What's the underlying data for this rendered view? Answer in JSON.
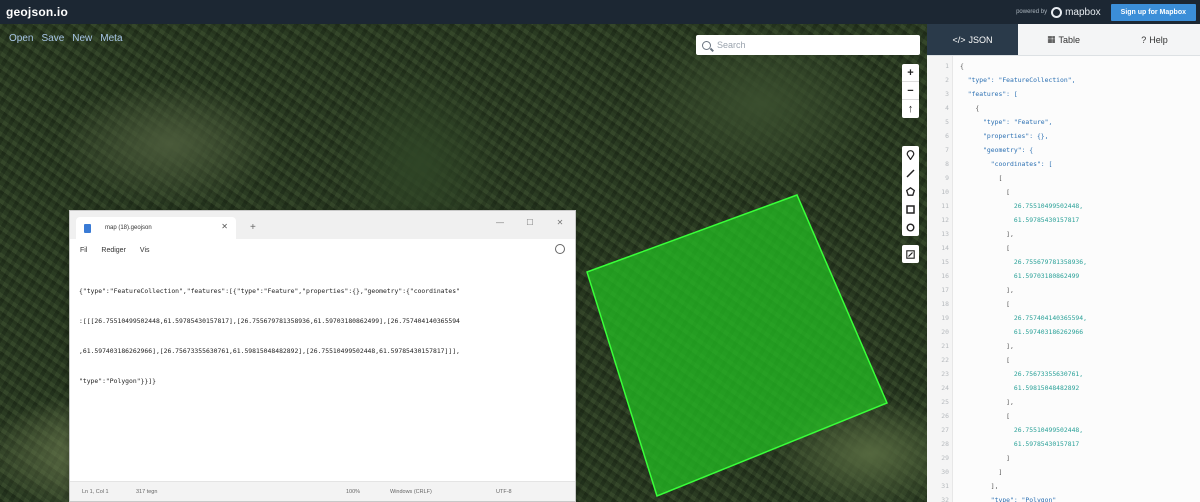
{
  "topbar": {
    "brand": "geojson.io",
    "powered_by": "powered by",
    "mapbox_label": "mapbox",
    "signup_label": "Sign up for Mapbox"
  },
  "map": {
    "menu": [
      "Open",
      "Save",
      "New",
      "Meta"
    ],
    "search_placeholder": "Search",
    "zoom_controls": [
      "+",
      "−",
      "↑"
    ],
    "draw_tools": [
      "marker-icon",
      "line-icon",
      "polygon-icon",
      "rectangle-icon",
      "circle-icon"
    ],
    "edit_tool": "edit-icon",
    "polygon_color": "#22c322"
  },
  "notepad": {
    "tab_title": "map (18).geojson",
    "menu": [
      "Fil",
      "Rediger",
      "Vis"
    ],
    "content_lines": [
      "{\"type\":\"FeatureCollection\",\"features\":[{\"type\":\"Feature\",\"properties\":{},\"geometry\":{\"coordinates\"",
      ":[[[26.75510499502448,61.59785430157817],[26.755679781358936,61.59703180862499],[26.757404140365594",
      ",61.597403186262966],[26.75673355630761,61.59815048482892],[26.75510499502448,61.59785430157817]]],",
      "\"type\":\"Polygon\"}}]}"
    ],
    "status": {
      "position": "Ln 1, Col 1",
      "chars": "317 tegn",
      "zoom": "100%",
      "line_ending": "Windows (CRLF)",
      "encoding": "UTF-8"
    }
  },
  "panel": {
    "tabs": [
      {
        "icon": "</>",
        "label": "JSON"
      },
      {
        "icon": "▦",
        "label": "Table"
      },
      {
        "icon": "?",
        "label": "Help"
      }
    ],
    "line_numbers": [
      "1",
      "2",
      "3",
      "4",
      "5",
      "6",
      "7",
      "8",
      "9",
      "10",
      "11",
      "12",
      "13",
      "14",
      "15",
      "16",
      "17",
      "18",
      "19",
      "20",
      "21",
      "22",
      "23",
      "24",
      "25",
      "26",
      "27",
      "28",
      "29",
      "30",
      "31",
      "32"
    ],
    "code_lines": [
      "{",
      "  \"type\": \"FeatureCollection\",",
      "  \"features\": [",
      "    {",
      "      \"type\": \"Feature\",",
      "      \"properties\": {},",
      "      \"geometry\": {",
      "        \"coordinates\": [",
      "          [",
      "            [",
      "              26.75510499502448,",
      "              61.59785430157817",
      "            ],",
      "            [",
      "              26.755679781358936,",
      "              61.59703180862499",
      "            ],",
      "            [",
      "              26.757404140365594,",
      "              61.597403186262966",
      "            ],",
      "            [",
      "              26.75673355630761,",
      "              61.59815048482892",
      "            ],",
      "            [",
      "              26.75510499502448,",
      "              61.59785430157817",
      "            ]",
      "          ]",
      "        ],",
      "        \"type\": \"Polygon\""
    ]
  }
}
